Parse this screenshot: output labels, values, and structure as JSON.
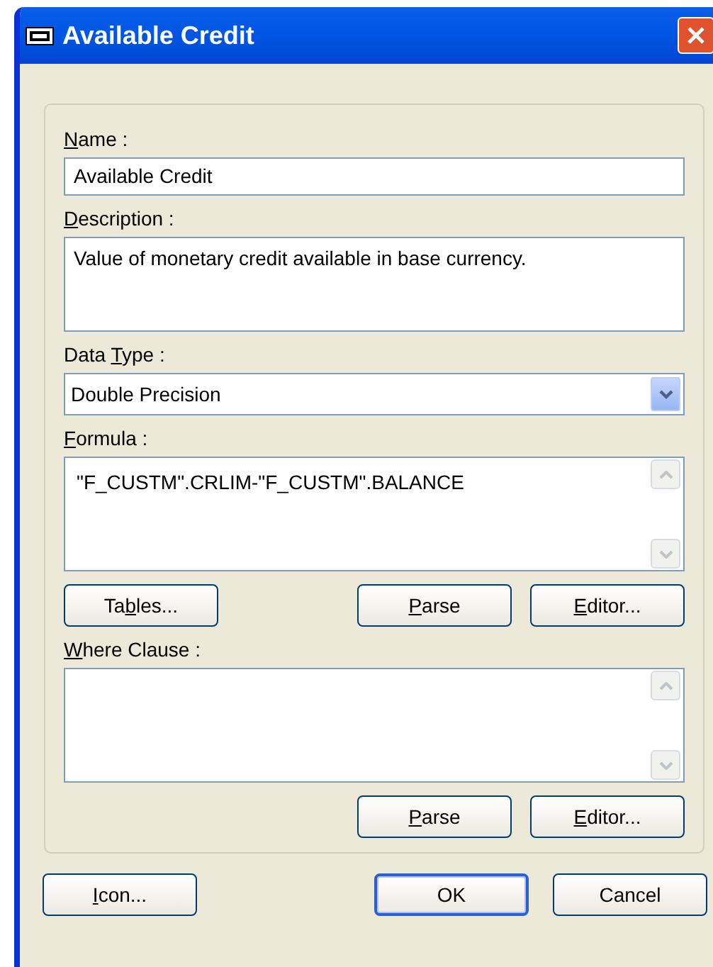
{
  "window": {
    "title": "Available Credit"
  },
  "fields": [
    {
      "kind": "text",
      "label": {
        "key": "N",
        "post": "ame :"
      },
      "value": "Available Credit"
    },
    {
      "kind": "memo",
      "label": {
        "key": "D",
        "post": "escription :"
      },
      "value": "Value of monetary credit available in base currency."
    },
    {
      "kind": "select",
      "label": {
        "pre": "Data ",
        "key": "T",
        "post": "ype :"
      },
      "value": "Double Precision"
    },
    {
      "kind": "memo-scroll",
      "label": {
        "key": "F",
        "post": "ormula :"
      },
      "value": "\"F_CUSTM\".CRLIM-\"F_CUSTM\".BALANCE",
      "buttons": {
        "left": [
          {
            "label": {
              "pre": "Ta",
              "key": "b",
              "post": "les..."
            }
          }
        ],
        "right": [
          {
            "label": {
              "key": "P",
              "post": "arse"
            }
          },
          {
            "label": {
              "key": "E",
              "post": "ditor..."
            }
          }
        ]
      }
    },
    {
      "kind": "memo-scroll",
      "label": {
        "key": "W",
        "post": "here Clause :"
      },
      "buttons": {
        "right": [
          {
            "label": {
              "key": "P",
              "post": "arse"
            }
          },
          {
            "label": {
              "key": "E",
              "post": "ditor..."
            }
          }
        ]
      }
    }
  ],
  "footer_buttons": {
    "left": [
      {
        "default": false,
        "label": {
          "key": "I",
          "post": "con..."
        }
      }
    ],
    "right": [
      {
        "default": true,
        "label": {
          "post": "OK"
        }
      },
      {
        "default": false,
        "label": {
          "post": "Cancel"
        }
      }
    ]
  }
}
